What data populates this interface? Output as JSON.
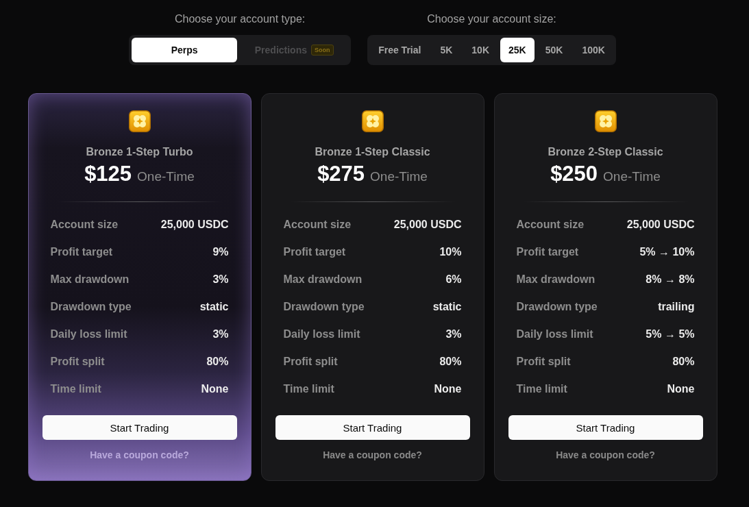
{
  "account_type": {
    "label": "Choose your account type:",
    "options": [
      {
        "label": "Perps",
        "selected": true,
        "disabled": false
      },
      {
        "label": "Predictions",
        "selected": false,
        "disabled": true,
        "badge": "Soon"
      }
    ]
  },
  "account_size": {
    "label": "Choose your account size:",
    "options": [
      {
        "label": "Free Trial",
        "selected": false
      },
      {
        "label": "5K",
        "selected": false
      },
      {
        "label": "10K",
        "selected": false
      },
      {
        "label": "25K",
        "selected": true
      },
      {
        "label": "50K",
        "selected": false
      },
      {
        "label": "100K",
        "selected": false
      }
    ]
  },
  "plans": [
    {
      "name": "Bronze 1-Step Turbo",
      "price": "$125",
      "billing": "One-Time",
      "selected": true,
      "specs": [
        {
          "label": "Account size",
          "value": "25,000 USDC"
        },
        {
          "label": "Profit target",
          "value": "9%"
        },
        {
          "label": "Max drawdown",
          "value": "3%"
        },
        {
          "label": "Drawdown type",
          "value": "static"
        },
        {
          "label": "Daily loss limit",
          "value": "3%"
        },
        {
          "label": "Profit split",
          "value": "80%"
        },
        {
          "label": "Time limit",
          "value": "None"
        }
      ],
      "button": "Start Trading",
      "coupon_link": "Have a coupon code?"
    },
    {
      "name": "Bronze 1-Step Classic",
      "price": "$275",
      "billing": "One-Time",
      "selected": false,
      "specs": [
        {
          "label": "Account size",
          "value": "25,000 USDC"
        },
        {
          "label": "Profit target",
          "value": "10%"
        },
        {
          "label": "Max drawdown",
          "value": "6%"
        },
        {
          "label": "Drawdown type",
          "value": "static"
        },
        {
          "label": "Daily loss limit",
          "value": "3%"
        },
        {
          "label": "Profit split",
          "value": "80%"
        },
        {
          "label": "Time limit",
          "value": "None"
        }
      ],
      "button": "Start Trading",
      "coupon_link": "Have a coupon code?"
    },
    {
      "name": "Bronze 2-Step Classic",
      "price": "$250",
      "billing": "One-Time",
      "selected": false,
      "specs": [
        {
          "label": "Account size",
          "value": "25,000 USDC"
        },
        {
          "label": "Profit target",
          "value": "5% → 10%"
        },
        {
          "label": "Max drawdown",
          "value": "8% → 8%"
        },
        {
          "label": "Drawdown type",
          "value": "trailing"
        },
        {
          "label": "Daily loss limit",
          "value": "5% → 5%"
        },
        {
          "label": "Profit split",
          "value": "80%"
        },
        {
          "label": "Time limit",
          "value": "None"
        }
      ],
      "button": "Start Trading",
      "coupon_link": "Have a coupon code?"
    }
  ]
}
